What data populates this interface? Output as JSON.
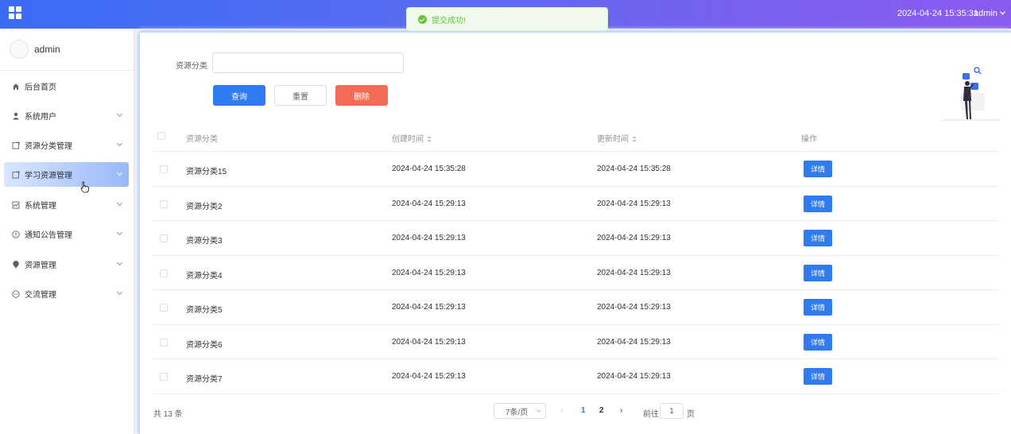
{
  "header": {
    "datetime": "2024-04-24 15:35:31",
    "user_label": "admin"
  },
  "toast": {
    "message": "提交成功!"
  },
  "sidebar": {
    "username": "admin",
    "items": [
      {
        "label": "后台首页",
        "icon": "home-icon"
      },
      {
        "label": "系统用户",
        "icon": "user-icon"
      },
      {
        "label": "资源分类管理",
        "icon": "folder-icon"
      },
      {
        "label": "学习资源管理",
        "icon": "folder-icon"
      },
      {
        "label": "系统管理",
        "icon": "chart-icon"
      },
      {
        "label": "通知公告管理",
        "icon": "info-icon"
      },
      {
        "label": "资源管理",
        "icon": "pin-icon"
      },
      {
        "label": "交流管理",
        "icon": "chat-icon"
      }
    ],
    "active_item": "学习资源管理"
  },
  "filter": {
    "label": "资源分类",
    "input_value": "",
    "query_label": "查询",
    "reset_label": "重置",
    "delete_label": "删除"
  },
  "table": {
    "headers": {
      "category": "资源分类",
      "created": "创建时间",
      "updated": "更新时间",
      "actions": "操作"
    },
    "detail_label": "详情",
    "rows": [
      {
        "category": "资源分类15",
        "created": "2024-04-24 15:35:28",
        "updated": "2024-04-24 15:35:28"
      },
      {
        "category": "资源分类2",
        "created": "2024-04-24 15:29:13",
        "updated": "2024-04-24 15:29:13"
      },
      {
        "category": "资源分类3",
        "created": "2024-04-24 15:29:13",
        "updated": "2024-04-24 15:29:13"
      },
      {
        "category": "资源分类4",
        "created": "2024-04-24 15:29:13",
        "updated": "2024-04-24 15:29:13"
      },
      {
        "category": "资源分类5",
        "created": "2024-04-24 15:29:13",
        "updated": "2024-04-24 15:29:13"
      },
      {
        "category": "资源分类6",
        "created": "2024-04-24 15:29:13",
        "updated": "2024-04-24 15:29:13"
      },
      {
        "category": "资源分类7",
        "created": "2024-04-24 15:29:13",
        "updated": "2024-04-24 15:29:13"
      }
    ]
  },
  "pagination": {
    "total_text": "共 13 条",
    "page_size": "7条/页",
    "pages": [
      "1",
      "2"
    ],
    "current_page": "1",
    "goto_label": "前往",
    "goto_value": "1",
    "goto_suffix": "页",
    "prev_glyph": "‹",
    "next_glyph": "›"
  },
  "colors": {
    "primary": "#2f7bf2",
    "danger": "#f56c56",
    "success": "#67c23a"
  }
}
